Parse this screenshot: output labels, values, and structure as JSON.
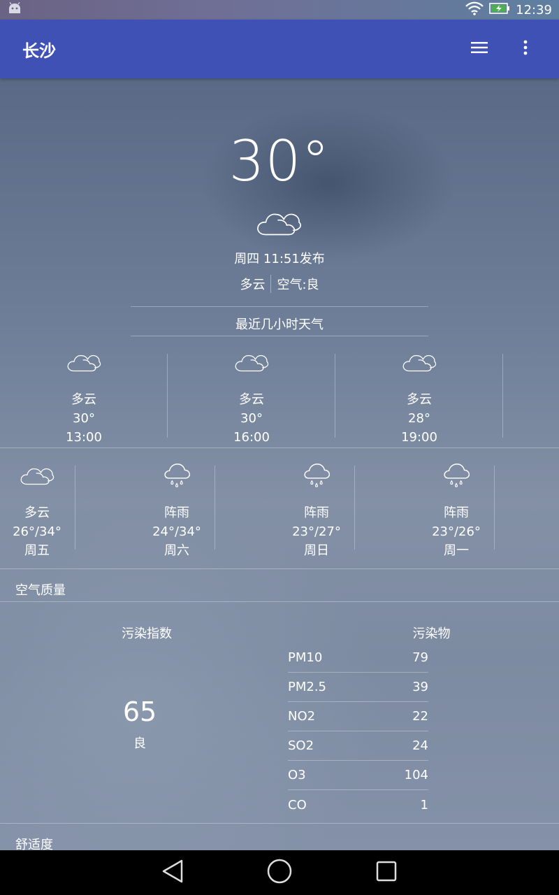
{
  "status_bar": {
    "time": "12:39",
    "icons": [
      "android-debug-icon",
      "wifi-icon",
      "battery-charging-icon"
    ]
  },
  "app_bar": {
    "title": "长沙",
    "actions": [
      "menu-icon",
      "more-vert-icon"
    ]
  },
  "current": {
    "temperature": "30°",
    "icon": "cloudy-icon",
    "publish_time": "周四  11:51发布",
    "condition": "多云",
    "air": "空气:良"
  },
  "recent_hours": {
    "title": "最近几小时天气",
    "items": [
      {
        "icon": "cloudy-icon",
        "condition": "多云",
        "temp": "30°",
        "time": "13:00"
      },
      {
        "icon": "cloudy-icon",
        "condition": "多云",
        "temp": "30°",
        "time": "16:00"
      },
      {
        "icon": "cloudy-icon",
        "condition": "多云",
        "temp": "28°",
        "time": "19:00"
      }
    ]
  },
  "forecast": [
    {
      "icon": "cloudy-icon",
      "condition": "多云",
      "temp": "26°/34°",
      "day": "周五"
    },
    {
      "icon": "shower-rain-icon",
      "condition": "阵雨",
      "temp": "24°/34°",
      "day": "周六"
    },
    {
      "icon": "shower-rain-icon",
      "condition": "阵雨",
      "temp": "23°/27°",
      "day": "周日"
    },
    {
      "icon": "shower-rain-icon",
      "condition": "阵雨",
      "temp": "23°/26°",
      "day": "周一"
    }
  ],
  "air_quality": {
    "title": "空气质量",
    "index_label": "污染指数",
    "index_value": "65",
    "index_level": "良",
    "pollutant_label": "污染物",
    "pollutants": [
      {
        "name": "PM10",
        "value": "79"
      },
      {
        "name": "PM2.5",
        "value": "39"
      },
      {
        "name": "NO2",
        "value": "22"
      },
      {
        "name": "SO2",
        "value": "24"
      },
      {
        "name": "O3",
        "value": "104"
      },
      {
        "name": "CO",
        "value": "1"
      }
    ]
  },
  "comfort": {
    "title": "舒适度"
  },
  "nav_bar": [
    "back-icon",
    "home-icon",
    "recents-icon"
  ]
}
